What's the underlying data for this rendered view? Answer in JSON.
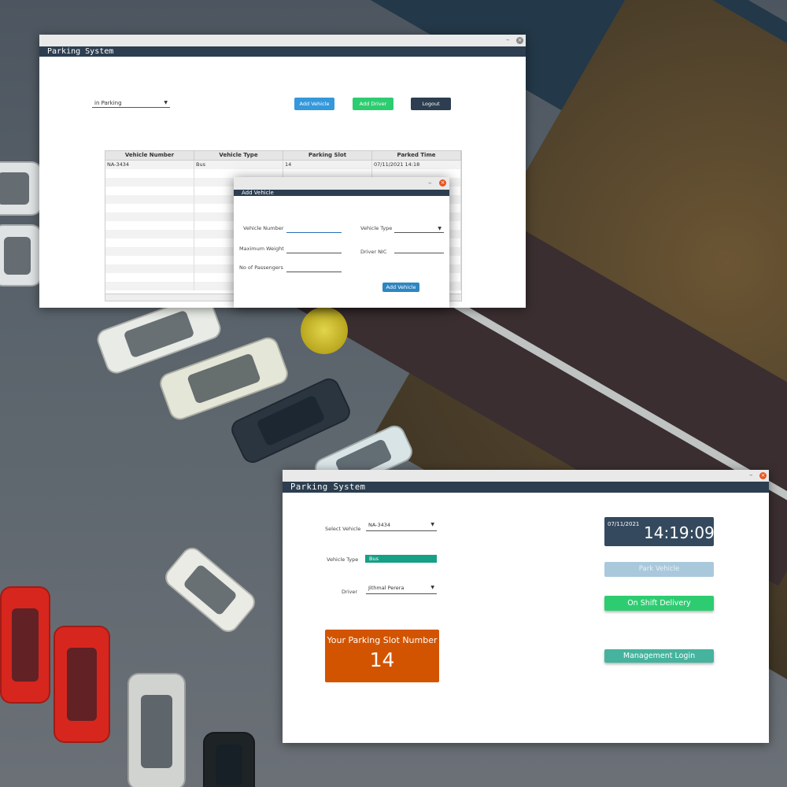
{
  "window_main": {
    "title": "Parking System",
    "filter_value": "in Parking",
    "buttons": {
      "add_vehicle": "Add Vehicle",
      "add_driver": "Add Driver",
      "logout": "Logout"
    },
    "table": {
      "columns": [
        "Vehicle Number",
        "Vehicle Type",
        "Parking Slot",
        "Parked Time"
      ],
      "rows": [
        [
          "NA-3434",
          "Bus",
          "14",
          "07/11/2021 14:18"
        ]
      ]
    }
  },
  "dialog": {
    "title": "Add Vehicle",
    "labels": {
      "vehicle_number": "Vehicle Number",
      "vehicle_type": "Vehicle Type",
      "maximum_weight": "Maximum Weight",
      "driver_nic": "Driver NIC",
      "no_of_passengers": "No of Passengers"
    },
    "submit": "Add Vehicle"
  },
  "window_park": {
    "title": "Parking System",
    "labels": {
      "select_vehicle": "Select Vehicle",
      "vehicle_type": "Vehicle Type",
      "driver": "Driver"
    },
    "select_vehicle_value": "NA-3434",
    "vehicle_type_value": "Bus",
    "driver_value": "Jithmal Perera",
    "slot": {
      "caption": "Your Parking Slot Number",
      "number": "14"
    },
    "clock": {
      "date": "07/11/2021",
      "time": "14:19:09"
    },
    "buttons": {
      "park_vehicle": "Park Vehicle",
      "on_shift_delivery": "On Shift Delivery",
      "management_login": "Management Login"
    }
  },
  "colors": {
    "header": "#2c3e50",
    "blue": "#3498db",
    "green": "#2ecc71",
    "dark": "#2c3e50",
    "teal": "#16a085",
    "orange": "#d35400",
    "clock": "#34495e",
    "mgmt": "#45b39d"
  },
  "icons": [
    "minimize-icon",
    "close-icon",
    "dropdown-arrow-icon"
  ]
}
